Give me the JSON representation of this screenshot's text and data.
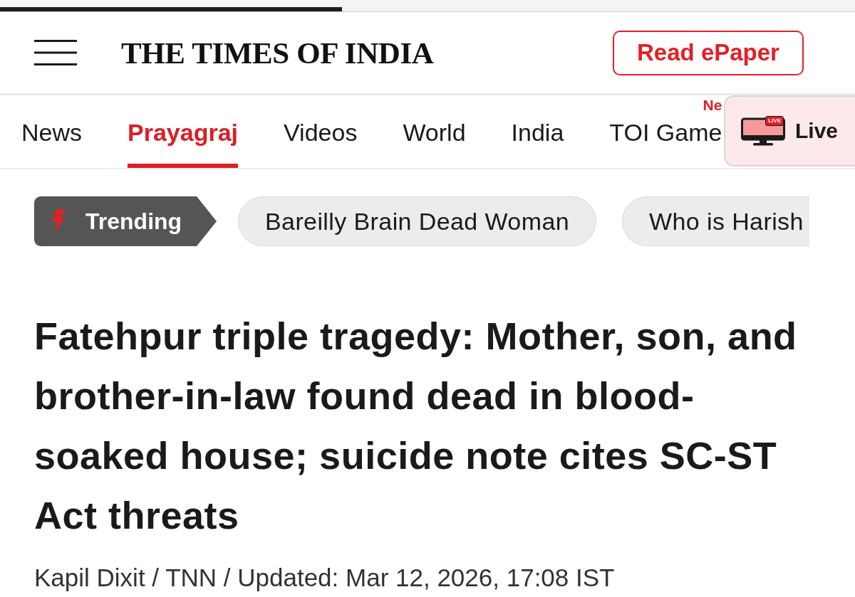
{
  "reading_progress": {
    "level": 0.4
  },
  "header": {
    "logo": "THE TIMES OF INDIA",
    "epaper_button": "Read ePaper"
  },
  "nav": {
    "items": [
      {
        "label": "News",
        "selected": false
      },
      {
        "label": "Prayagraj",
        "selected": true
      },
      {
        "label": "Videos",
        "selected": false
      },
      {
        "label": "World",
        "selected": false
      },
      {
        "label": "India",
        "selected": false
      },
      {
        "label": "TOI Game",
        "selected": false,
        "badge": "Ne"
      }
    ],
    "live_button": {
      "label": "Live",
      "badge": "LIVE"
    }
  },
  "trending": {
    "label": "Trending",
    "topics": [
      "Bareilly Brain Dead Woman",
      "Who is Harish"
    ]
  },
  "article": {
    "headline": "Fatehpur triple tragedy: Mother, son, and brother-in-law found dead in blood-soaked house; suicide note cites SC-ST Act threats",
    "byline": "Kapil Dixit / TNN / Updated: Mar 12, 2026, 17:08 IST"
  }
}
